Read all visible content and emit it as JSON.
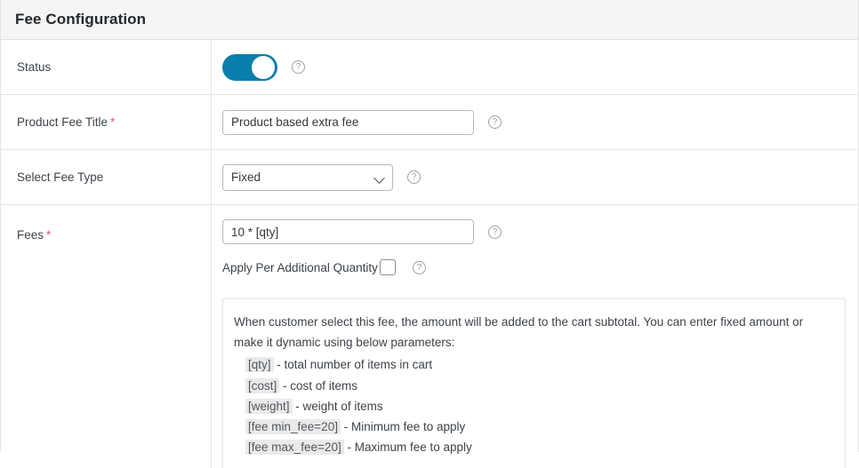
{
  "header": {
    "title": "Fee Configuration"
  },
  "rows": {
    "status": {
      "label": "Status",
      "toggle_on": true,
      "help_icon": "help-circle-icon",
      "help_glyph": "?"
    },
    "product_fee_title": {
      "label": "Product Fee Title",
      "required_marker": "*",
      "value": "Product based extra fee",
      "placeholder": "",
      "help_glyph": "?"
    },
    "select_fee_type": {
      "label": "Select Fee Type",
      "selected": "Fixed",
      "options": [
        "Fixed"
      ],
      "chevron_icon": "chevron-down-icon",
      "help_glyph": "?"
    },
    "fees": {
      "label": "Fees",
      "required_marker": "*",
      "value": "10 * [qty]",
      "placeholder": "",
      "help_glyph": "?",
      "checkbox_label": "Apply Per Additional Quantity",
      "checkbox_checked": false,
      "checkbox_help_glyph": "?"
    }
  },
  "help_box": {
    "paragraph": "When customer select this fee, the amount will be added to the cart subtotal. You can enter fixed amount or make it dynamic using below parameters:",
    "parameters": [
      {
        "token": "[qty]",
        "description": "- total number of items in cart"
      },
      {
        "token": "[cost]",
        "description": "- cost of items"
      },
      {
        "token": "[weight]",
        "description": "- weight of items"
      },
      {
        "token": "[fee min_fee=20]",
        "description": "- Minimum fee to apply"
      },
      {
        "token": "[fee max_fee=20]",
        "description": "- Maximum fee to apply"
      }
    ]
  },
  "colors": {
    "toggle_on": "#0a7eab",
    "required_asterisk": "#e2586f",
    "header_bg": "#f5f5f5",
    "token_bg": "#eaeaea"
  }
}
